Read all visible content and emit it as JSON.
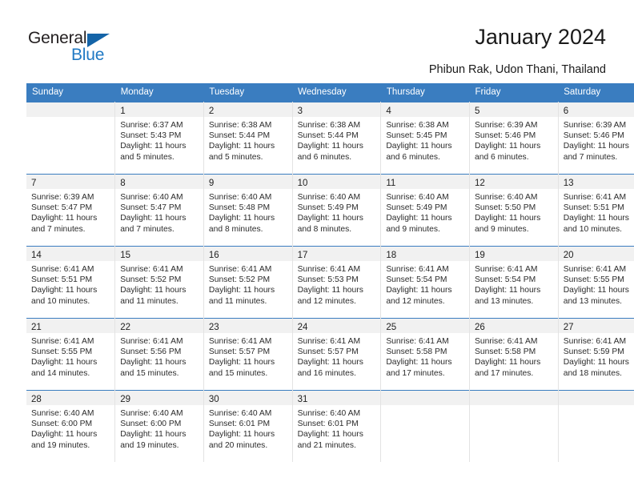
{
  "brand": {
    "name_part1": "General",
    "name_part2": "Blue",
    "triangle_color": "#1464a8",
    "blue_text_color": "#2079c4"
  },
  "header": {
    "title": "January 2024",
    "location": "Phibun Rak, Udon Thani, Thailand"
  },
  "theme": {
    "header_blue": "#3a7dc0",
    "daynum_band": "#f1f1f1",
    "grid_line": "#e3e3e3"
  },
  "weekday_headers": [
    "Sunday",
    "Monday",
    "Tuesday",
    "Wednesday",
    "Thursday",
    "Friday",
    "Saturday"
  ],
  "labels": {
    "sunrise_prefix": "Sunrise: ",
    "sunset_prefix": "Sunset: ",
    "daylight_prefix": "Daylight: "
  },
  "weeks": [
    [
      {
        "day": "",
        "sunrise": "",
        "sunset": "",
        "daylight_line1": "",
        "daylight_line2": ""
      },
      {
        "day": "1",
        "sunrise": "Sunrise: 6:37 AM",
        "sunset": "Sunset: 5:43 PM",
        "daylight_line1": "Daylight: 11 hours",
        "daylight_line2": "and 5 minutes."
      },
      {
        "day": "2",
        "sunrise": "Sunrise: 6:38 AM",
        "sunset": "Sunset: 5:44 PM",
        "daylight_line1": "Daylight: 11 hours",
        "daylight_line2": "and 5 minutes."
      },
      {
        "day": "3",
        "sunrise": "Sunrise: 6:38 AM",
        "sunset": "Sunset: 5:44 PM",
        "daylight_line1": "Daylight: 11 hours",
        "daylight_line2": "and 6 minutes."
      },
      {
        "day": "4",
        "sunrise": "Sunrise: 6:38 AM",
        "sunset": "Sunset: 5:45 PM",
        "daylight_line1": "Daylight: 11 hours",
        "daylight_line2": "and 6 minutes."
      },
      {
        "day": "5",
        "sunrise": "Sunrise: 6:39 AM",
        "sunset": "Sunset: 5:46 PM",
        "daylight_line1": "Daylight: 11 hours",
        "daylight_line2": "and 6 minutes."
      },
      {
        "day": "6",
        "sunrise": "Sunrise: 6:39 AM",
        "sunset": "Sunset: 5:46 PM",
        "daylight_line1": "Daylight: 11 hours",
        "daylight_line2": "and 7 minutes."
      }
    ],
    [
      {
        "day": "7",
        "sunrise": "Sunrise: 6:39 AM",
        "sunset": "Sunset: 5:47 PM",
        "daylight_line1": "Daylight: 11 hours",
        "daylight_line2": "and 7 minutes."
      },
      {
        "day": "8",
        "sunrise": "Sunrise: 6:40 AM",
        "sunset": "Sunset: 5:47 PM",
        "daylight_line1": "Daylight: 11 hours",
        "daylight_line2": "and 7 minutes."
      },
      {
        "day": "9",
        "sunrise": "Sunrise: 6:40 AM",
        "sunset": "Sunset: 5:48 PM",
        "daylight_line1": "Daylight: 11 hours",
        "daylight_line2": "and 8 minutes."
      },
      {
        "day": "10",
        "sunrise": "Sunrise: 6:40 AM",
        "sunset": "Sunset: 5:49 PM",
        "daylight_line1": "Daylight: 11 hours",
        "daylight_line2": "and 8 minutes."
      },
      {
        "day": "11",
        "sunrise": "Sunrise: 6:40 AM",
        "sunset": "Sunset: 5:49 PM",
        "daylight_line1": "Daylight: 11 hours",
        "daylight_line2": "and 9 minutes."
      },
      {
        "day": "12",
        "sunrise": "Sunrise: 6:40 AM",
        "sunset": "Sunset: 5:50 PM",
        "daylight_line1": "Daylight: 11 hours",
        "daylight_line2": "and 9 minutes."
      },
      {
        "day": "13",
        "sunrise": "Sunrise: 6:41 AM",
        "sunset": "Sunset: 5:51 PM",
        "daylight_line1": "Daylight: 11 hours",
        "daylight_line2": "and 10 minutes."
      }
    ],
    [
      {
        "day": "14",
        "sunrise": "Sunrise: 6:41 AM",
        "sunset": "Sunset: 5:51 PM",
        "daylight_line1": "Daylight: 11 hours",
        "daylight_line2": "and 10 minutes."
      },
      {
        "day": "15",
        "sunrise": "Sunrise: 6:41 AM",
        "sunset": "Sunset: 5:52 PM",
        "daylight_line1": "Daylight: 11 hours",
        "daylight_line2": "and 11 minutes."
      },
      {
        "day": "16",
        "sunrise": "Sunrise: 6:41 AM",
        "sunset": "Sunset: 5:52 PM",
        "daylight_line1": "Daylight: 11 hours",
        "daylight_line2": "and 11 minutes."
      },
      {
        "day": "17",
        "sunrise": "Sunrise: 6:41 AM",
        "sunset": "Sunset: 5:53 PM",
        "daylight_line1": "Daylight: 11 hours",
        "daylight_line2": "and 12 minutes."
      },
      {
        "day": "18",
        "sunrise": "Sunrise: 6:41 AM",
        "sunset": "Sunset: 5:54 PM",
        "daylight_line1": "Daylight: 11 hours",
        "daylight_line2": "and 12 minutes."
      },
      {
        "day": "19",
        "sunrise": "Sunrise: 6:41 AM",
        "sunset": "Sunset: 5:54 PM",
        "daylight_line1": "Daylight: 11 hours",
        "daylight_line2": "and 13 minutes."
      },
      {
        "day": "20",
        "sunrise": "Sunrise: 6:41 AM",
        "sunset": "Sunset: 5:55 PM",
        "daylight_line1": "Daylight: 11 hours",
        "daylight_line2": "and 13 minutes."
      }
    ],
    [
      {
        "day": "21",
        "sunrise": "Sunrise: 6:41 AM",
        "sunset": "Sunset: 5:55 PM",
        "daylight_line1": "Daylight: 11 hours",
        "daylight_line2": "and 14 minutes."
      },
      {
        "day": "22",
        "sunrise": "Sunrise: 6:41 AM",
        "sunset": "Sunset: 5:56 PM",
        "daylight_line1": "Daylight: 11 hours",
        "daylight_line2": "and 15 minutes."
      },
      {
        "day": "23",
        "sunrise": "Sunrise: 6:41 AM",
        "sunset": "Sunset: 5:57 PM",
        "daylight_line1": "Daylight: 11 hours",
        "daylight_line2": "and 15 minutes."
      },
      {
        "day": "24",
        "sunrise": "Sunrise: 6:41 AM",
        "sunset": "Sunset: 5:57 PM",
        "daylight_line1": "Daylight: 11 hours",
        "daylight_line2": "and 16 minutes."
      },
      {
        "day": "25",
        "sunrise": "Sunrise: 6:41 AM",
        "sunset": "Sunset: 5:58 PM",
        "daylight_line1": "Daylight: 11 hours",
        "daylight_line2": "and 17 minutes."
      },
      {
        "day": "26",
        "sunrise": "Sunrise: 6:41 AM",
        "sunset": "Sunset: 5:58 PM",
        "daylight_line1": "Daylight: 11 hours",
        "daylight_line2": "and 17 minutes."
      },
      {
        "day": "27",
        "sunrise": "Sunrise: 6:41 AM",
        "sunset": "Sunset: 5:59 PM",
        "daylight_line1": "Daylight: 11 hours",
        "daylight_line2": "and 18 minutes."
      }
    ],
    [
      {
        "day": "28",
        "sunrise": "Sunrise: 6:40 AM",
        "sunset": "Sunset: 6:00 PM",
        "daylight_line1": "Daylight: 11 hours",
        "daylight_line2": "and 19 minutes."
      },
      {
        "day": "29",
        "sunrise": "Sunrise: 6:40 AM",
        "sunset": "Sunset: 6:00 PM",
        "daylight_line1": "Daylight: 11 hours",
        "daylight_line2": "and 19 minutes."
      },
      {
        "day": "30",
        "sunrise": "Sunrise: 6:40 AM",
        "sunset": "Sunset: 6:01 PM",
        "daylight_line1": "Daylight: 11 hours",
        "daylight_line2": "and 20 minutes."
      },
      {
        "day": "31",
        "sunrise": "Sunrise: 6:40 AM",
        "sunset": "Sunset: 6:01 PM",
        "daylight_line1": "Daylight: 11 hours",
        "daylight_line2": "and 21 minutes."
      },
      {
        "day": "",
        "sunrise": "",
        "sunset": "",
        "daylight_line1": "",
        "daylight_line2": ""
      },
      {
        "day": "",
        "sunrise": "",
        "sunset": "",
        "daylight_line1": "",
        "daylight_line2": ""
      },
      {
        "day": "",
        "sunrise": "",
        "sunset": "",
        "daylight_line1": "",
        "daylight_line2": ""
      }
    ]
  ]
}
